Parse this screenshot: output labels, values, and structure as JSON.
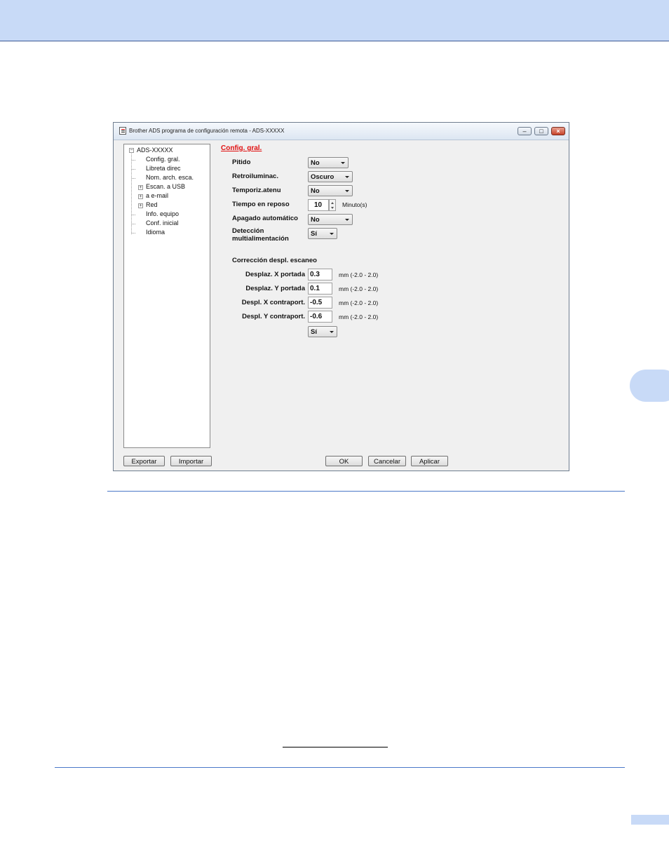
{
  "window": {
    "title": "Brother ADS programa de configuración remota - ADS-XXXXX",
    "controls": {
      "minimize": "‒",
      "maximize": "□",
      "close": "×"
    }
  },
  "tree": {
    "root": "ADS-XXXXX",
    "root_expander": "−",
    "items": [
      {
        "label": "Config. gral.",
        "expander": ""
      },
      {
        "label": "Libreta direc",
        "expander": ""
      },
      {
        "label": "Nom. arch. esca.",
        "expander": ""
      },
      {
        "label": "Escan. a USB",
        "expander": "+"
      },
      {
        "label": "a e-mail",
        "expander": "+"
      },
      {
        "label": "Red",
        "expander": "+"
      },
      {
        "label": "Info. equipo",
        "expander": ""
      },
      {
        "label": "Conf. inicial",
        "expander": ""
      },
      {
        "label": "Idioma",
        "expander": ""
      }
    ]
  },
  "main": {
    "section_title": "Config. gral.",
    "fields": {
      "pitido": {
        "label": "Pitido",
        "value": "No"
      },
      "retroiluminac": {
        "label": "Retroiluminac.",
        "value": "Oscuro"
      },
      "temporiz": {
        "label": "Temporiz.atenu",
        "value": "No"
      },
      "reposo": {
        "label": "Tiempo en reposo",
        "value": "10",
        "unit": "Minuto(s)"
      },
      "apagado": {
        "label": "Apagado automático",
        "value": "No"
      },
      "deteccion": {
        "label_line1": "Detección",
        "label_line2": "multialimentación",
        "value": "Sí"
      }
    },
    "correction": {
      "heading": "Corrección despl. escaneo",
      "rows": [
        {
          "label": "Desplaz. X portada",
          "value": "0.3",
          "unit": "mm (-2.0 - 2.0)"
        },
        {
          "label": "Desplaz. Y portada",
          "value": "0.1",
          "unit": "mm (-2.0 - 2.0)"
        },
        {
          "label": "Despl. X contraport.",
          "value": "-0.5",
          "unit": "mm (-2.0 - 2.0)"
        },
        {
          "label": "Despl. Y contraport.",
          "value": "-0.6",
          "unit": "mm (-2.0 - 2.0)"
        }
      ],
      "extra_value": "Sí"
    }
  },
  "buttons": {
    "exportar": "Exportar",
    "importar": "Importar",
    "ok": "OK",
    "cancelar": "Cancelar",
    "aplicar": "Aplicar"
  }
}
